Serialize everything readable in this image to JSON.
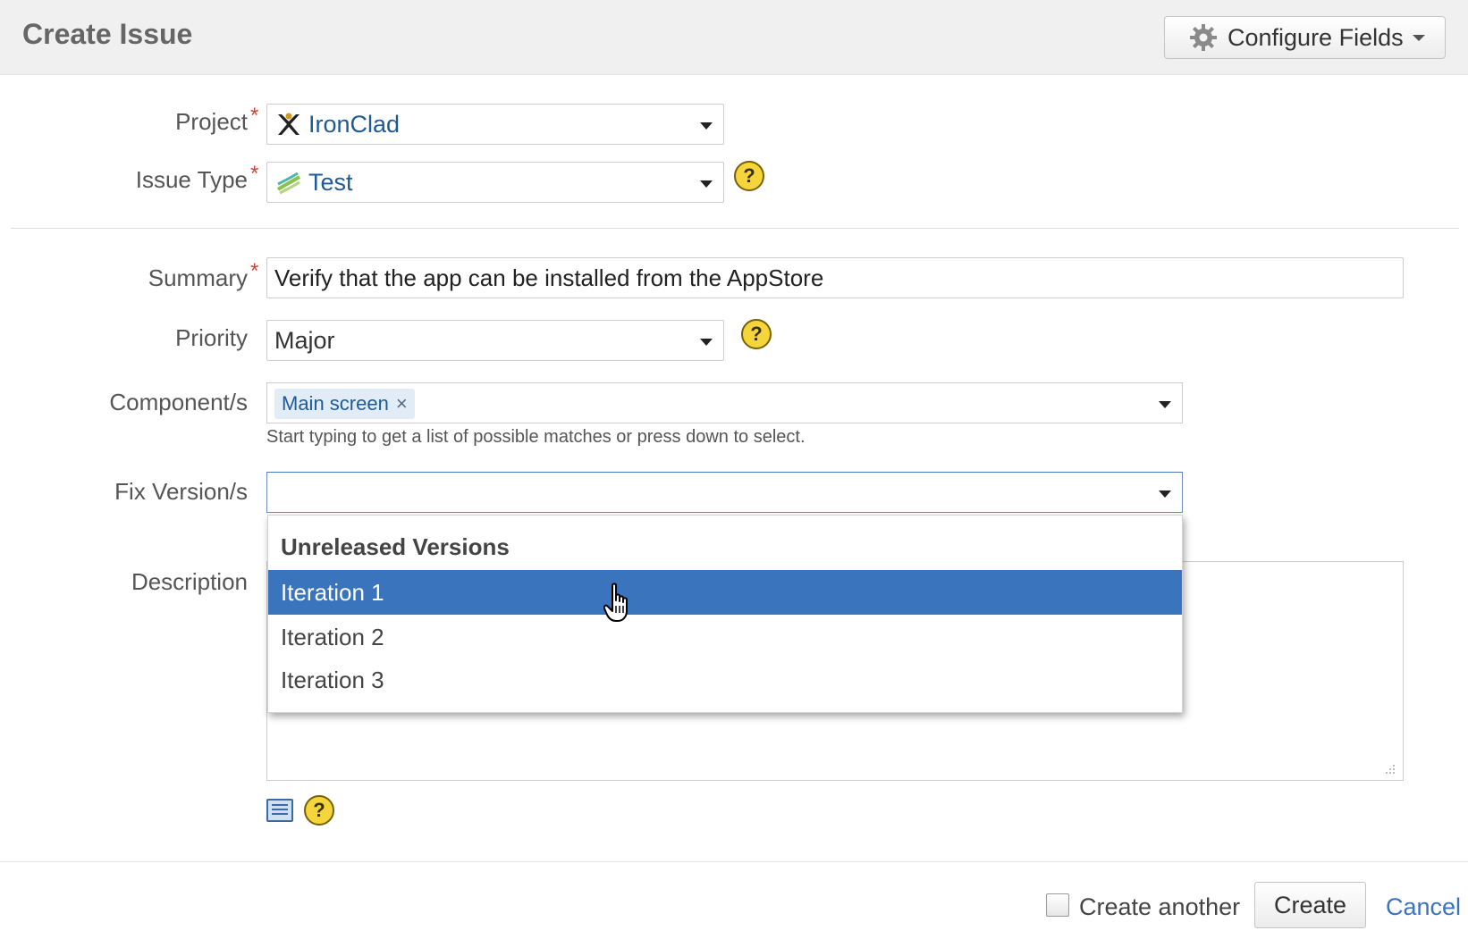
{
  "header": {
    "title": "Create Issue",
    "configure_fields_label": "Configure Fields"
  },
  "form": {
    "project": {
      "label": "Project",
      "value": "IronClad"
    },
    "issue_type": {
      "label": "Issue Type",
      "value": "Test"
    },
    "summary": {
      "label": "Summary",
      "value": "Verify that the app can be installed from the AppStore"
    },
    "priority": {
      "label": "Priority",
      "value": "Major"
    },
    "components": {
      "label": "Component/s",
      "chips": [
        "Main screen"
      ],
      "chip_remove": "×",
      "hint": "Start typing to get a list of possible matches or press down to select."
    },
    "fix_versions": {
      "label": "Fix Version/s",
      "value": "",
      "dropdown": {
        "group_header": "Unreleased Versions",
        "items": [
          "Iteration 1",
          "Iteration 2",
          "Iteration 3"
        ],
        "highlighted_index": 0
      }
    },
    "description": {
      "label": "Description",
      "value": ""
    },
    "required_marker": "*",
    "help_glyph": "?"
  },
  "footer": {
    "create_another_label": "Create another",
    "create_another_checked": false,
    "create_label": "Create",
    "cancel_label": "Cancel"
  },
  "icons": {
    "project": "ironclad-project-icon",
    "issue_type": "test-issue-type-icon",
    "gear": "gear-icon",
    "wiki": "wiki-markup-icon",
    "help": "help-icon",
    "cursor": "hand-pointer-cursor-icon"
  },
  "colors": {
    "header_bg": "#f0f0f0",
    "required": "#d04437",
    "link": "#1f5a98",
    "highlight": "#3a74bd",
    "help_bg": "#f4d53b"
  }
}
